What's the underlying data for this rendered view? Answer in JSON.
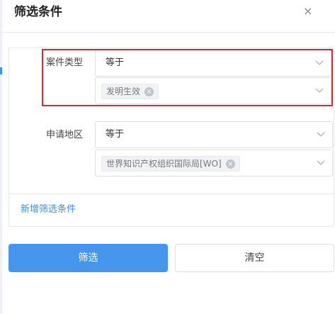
{
  "dialog": {
    "title": "筛选条件",
    "close_symbol": "×"
  },
  "conditions": [
    {
      "label": "案件类型",
      "operator": "等于",
      "tags": [
        "发明生效"
      ]
    },
    {
      "label": "申请地区",
      "operator": "等于",
      "tags": [
        "世界知识产权组织国际局[WO]"
      ]
    }
  ],
  "add_condition_label": "新增筛选条件",
  "buttons": {
    "filter_label": "筛选",
    "clear_label": "清空"
  },
  "colors": {
    "accent": "#4696ee",
    "link": "#3f8fe8",
    "highlight_border": "#d62b34"
  },
  "icons": {
    "close": "close-icon",
    "dropdown": "chevron-down-icon",
    "tag_remove": "tag-remove-icon"
  }
}
